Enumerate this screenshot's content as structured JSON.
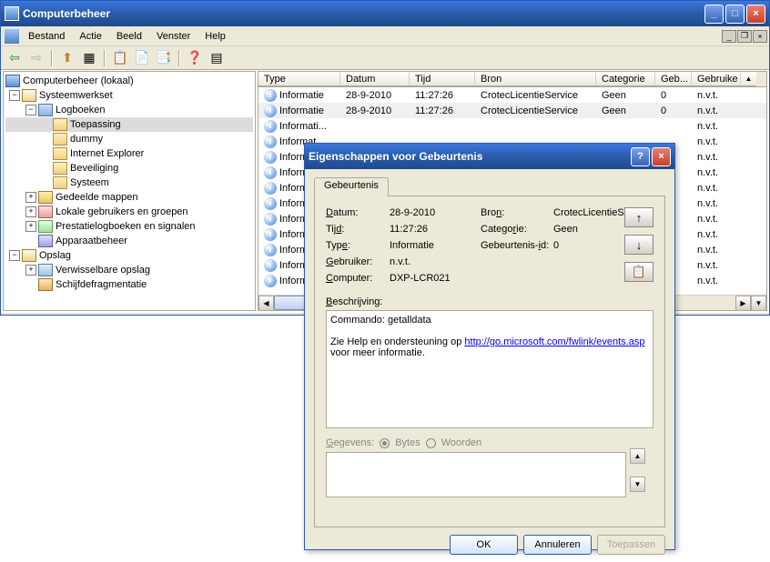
{
  "window": {
    "title": "Computerbeheer",
    "menus": [
      "Bestand",
      "Actie",
      "Beeld",
      "Venster",
      "Help"
    ]
  },
  "tree": {
    "root": "Computerbeheer (lokaal)",
    "sys": "Systeemwerkset",
    "logbooks": "Logboeken",
    "logs": [
      "Toepassing",
      "dummy",
      "Internet Explorer",
      "Beveiliging",
      "Systeem"
    ],
    "shared": "Gedeelde mappen",
    "users": "Lokale gebruikers en groepen",
    "perf": "Prestatielogboeken en signalen",
    "device": "Apparaatbeheer",
    "storage": "Opslag",
    "removable": "Verwisselbare opslag",
    "defrag": "Schijfdefragmentatie"
  },
  "list": {
    "cols": {
      "type": "Type",
      "date": "Datum",
      "time": "Tijd",
      "source": "Bron",
      "cat": "Categorie",
      "evt": "Geb...",
      "user": "Gebruike"
    },
    "rows": [
      {
        "type": "Informatie",
        "date": "28-9-2010",
        "time": "11:27:26",
        "source": "CrotecLicentieService",
        "cat": "Geen",
        "evt": "0",
        "user": "n.v.t."
      },
      {
        "type": "Informatie",
        "date": "28-9-2010",
        "time": "11:27:26",
        "source": "CrotecLicentieService",
        "cat": "Geen",
        "evt": "0",
        "user": "n.v.t."
      },
      {
        "type": "Informati...",
        "date": "",
        "time": "",
        "source": "",
        "cat": "",
        "evt": "",
        "user": "n.v.t."
      },
      {
        "type": "Informat",
        "date": "",
        "time": "",
        "source": "",
        "cat": "",
        "evt": "",
        "user": "n.v.t."
      },
      {
        "type": "Informat",
        "date": "",
        "time": "",
        "source": "",
        "cat": "",
        "evt": "",
        "user": "n.v.t."
      },
      {
        "type": "Informat",
        "date": "",
        "time": "",
        "source": "",
        "cat": "",
        "evt": "",
        "user": "n.v.t."
      },
      {
        "type": "Informat",
        "date": "",
        "time": "",
        "source": "",
        "cat": "",
        "evt": "",
        "user": "n.v.t."
      },
      {
        "type": "Informat",
        "date": "",
        "time": "",
        "source": "",
        "cat": "",
        "evt": "",
        "user": "n.v.t."
      },
      {
        "type": "Informat",
        "date": "",
        "time": "",
        "source": "",
        "cat": "",
        "evt": "",
        "user": "n.v.t."
      },
      {
        "type": "Informat",
        "date": "",
        "time": "",
        "source": "",
        "cat": "",
        "evt": "",
        "user": "n.v.t."
      },
      {
        "type": "Informat",
        "date": "",
        "time": "",
        "source": "",
        "cat": "",
        "evt": "",
        "user": "n.v.t."
      },
      {
        "type": "Informat",
        "date": "",
        "time": "",
        "source": "",
        "cat": "",
        "evt": "",
        "user": "n.v.t."
      },
      {
        "type": "Informat",
        "date": "",
        "time": "",
        "source": "",
        "cat": "",
        "evt": "",
        "user": "n.v.t."
      }
    ]
  },
  "dialog": {
    "title": "Eigenschappen voor Gebeurtenis",
    "tab": "Gebeurtenis",
    "labels": {
      "date": "Datum:",
      "time": "Tijd:",
      "type": "Type:",
      "user": "Gebruiker:",
      "computer": "Computer:",
      "source": "Bron:",
      "cat": "Categorie:",
      "eventid": "Gebeurtenis-id:",
      "desc": "Beschrijving:",
      "data": "Gegevens:",
      "bytes": "Bytes",
      "words": "Woorden"
    },
    "values": {
      "date": "28-9-2010",
      "time": "11:27:26",
      "type": "Informatie",
      "user": "n.v.t.",
      "computer": "DXP-LCR021",
      "source": "CrotecLicentieService",
      "cat": "Geen",
      "eventid": "0"
    },
    "desc_line1": "Commando: getalldata",
    "desc_line2a": "Zie Help en ondersteuning op ",
    "desc_link": "http://go.microsoft.com/fwlink/events.asp",
    "desc_line2b": " voor meer informatie.",
    "buttons": {
      "ok": "OK",
      "cancel": "Annuleren",
      "apply": "Toepassen"
    }
  }
}
